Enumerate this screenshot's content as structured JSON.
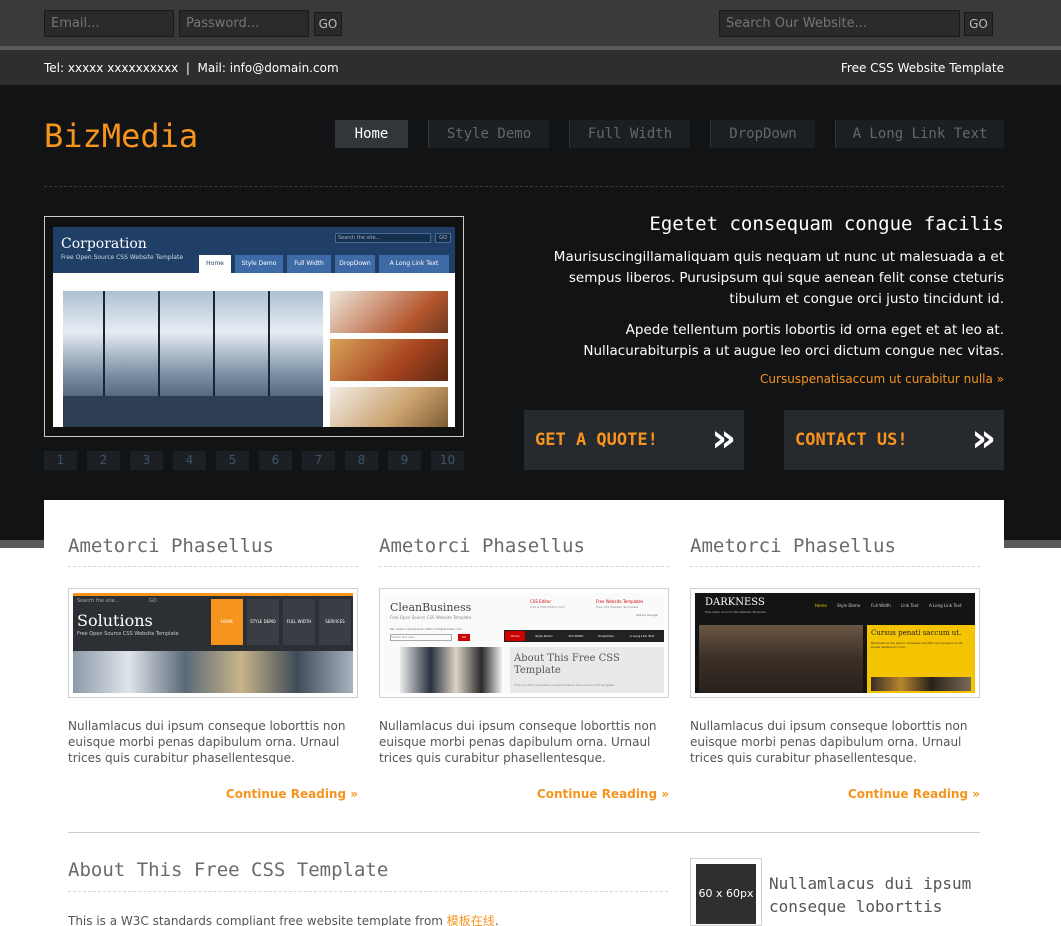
{
  "topbar": {
    "email_placeholder": "Email...",
    "password_placeholder": "Password...",
    "login_go": "GO",
    "search_placeholder": "Search Our Website...",
    "search_go": "GO"
  },
  "strip": {
    "contact": "Tel: xxxxx xxxxxxxxxx  |  Mail: info@domain.com",
    "tagline": "Free CSS Website Template"
  },
  "header": {
    "logo": "BizMedia",
    "nav": [
      "Home",
      "Style Demo",
      "Full Width",
      "DropDown",
      "A Long Link Text"
    ]
  },
  "slideshow": {
    "title": "Corporation",
    "subtitle": "Free Open Source CSS Website Template",
    "search_placeholder": "Search the site...",
    "search_go": "GO",
    "nav": [
      "Home",
      "Style Demo",
      "Full Width",
      "DropDown",
      "A Long Link Text"
    ],
    "pager": [
      "1",
      "2",
      "3",
      "4",
      "5",
      "6",
      "7",
      "8",
      "9",
      "10"
    ]
  },
  "hero": {
    "heading": "Egetet consequam congue facilis",
    "para1": "Maurisuscingillamaliquam quis nequam ut nunc ut malesuada a et sempus liberos. Purusipsum qui sque aenean felit conse cteturis tibulum et congue orci justo tincidunt id.",
    "para2": "Apede tellentum portis lobortis id orna eget et at leo at. Nullacurabiturpis a ut augue leo orci dictum congue nec vitas.",
    "link": "Cursuspenatisaccum ut curabitur nulla »",
    "cta_quote": "GET A QUOTE!",
    "cta_contact": "CONTACT US!",
    "cta_arrow": "»"
  },
  "columns": [
    {
      "heading": "Ametorci Phasellus",
      "thumb": {
        "title": "Solutions",
        "subtitle": "Free Open Source CSS Website Template",
        "search": "Search the site...",
        "go": "GO",
        "nav": [
          "HOME",
          "STYLE DEMO",
          "FULL WIDTH",
          "SERVICES"
        ]
      },
      "text": "Nullamlacus dui ipsum conseque loborttis non euisque morbi penas dapibulum orna. Urnaul trices quis curabitur phasellentesque.",
      "more": "Continue Reading »"
    },
    {
      "heading": "Ametorci Phasellus",
      "thumb": {
        "title": "CleanBusiness",
        "subtitle": "Free Open Source CSS Website Template",
        "search": "Search the site...",
        "go": "GO",
        "contact": "Tel: xxxxx xxxxxxxxxx | Mail: info@domain.com",
        "box1_title": "CSS Editor",
        "box1_text": "CSS & XML Editing Tool",
        "box2_title": "Free Website Templates",
        "box2_text": "Free CSS Website Templates",
        "ad": "Ads by Google",
        "nav": [
          "Home",
          "Style Demo",
          "Full Width",
          "DropDown",
          "A Long Link Text"
        ],
        "caption": "About This Free CSS Template",
        "caption_sub": "This is a W3C standards compliant Open Source free CSS template"
      },
      "text": "Nullamlacus dui ipsum conseque loborttis non euisque morbi penas dapibulum orna. Urnaul trices quis curabitur phasellentesque.",
      "more": "Continue Reading »"
    },
    {
      "heading": "Ametorci Phasellus",
      "thumb": {
        "title": "DARKNESS",
        "subtitle": "Free Open Source CSS Website Template",
        "nav": [
          "Home",
          "Style Demo",
          "Full Width",
          "Link Text",
          "A Long Link Text"
        ],
        "caption": "Cursus penati saccum ut.",
        "caption_text": "Nullamlacus dui ipsum conseque loborttis non euisque morbi penas dapibulum orna."
      },
      "text": "Nullamlacus dui ipsum conseque loborttis non euisque morbi penas dapibulum orna. Urnaul trices quis curabitur phasellentesque.",
      "more": "Continue Reading »"
    }
  ],
  "about": {
    "heading": "About This Free CSS Template",
    "text_prefix": "This is a W3C standards compliant free website template from ",
    "link": "模板在线",
    "text_suffix": "."
  },
  "sidebar": {
    "placeholder": "60 x 60px",
    "heading": "Nullamlacus dui ipsum conseque loborttis"
  },
  "colors": {
    "accent": "#f7941d",
    "hero_bg": "#111315",
    "topbar_bg": "#3a3a3a"
  }
}
